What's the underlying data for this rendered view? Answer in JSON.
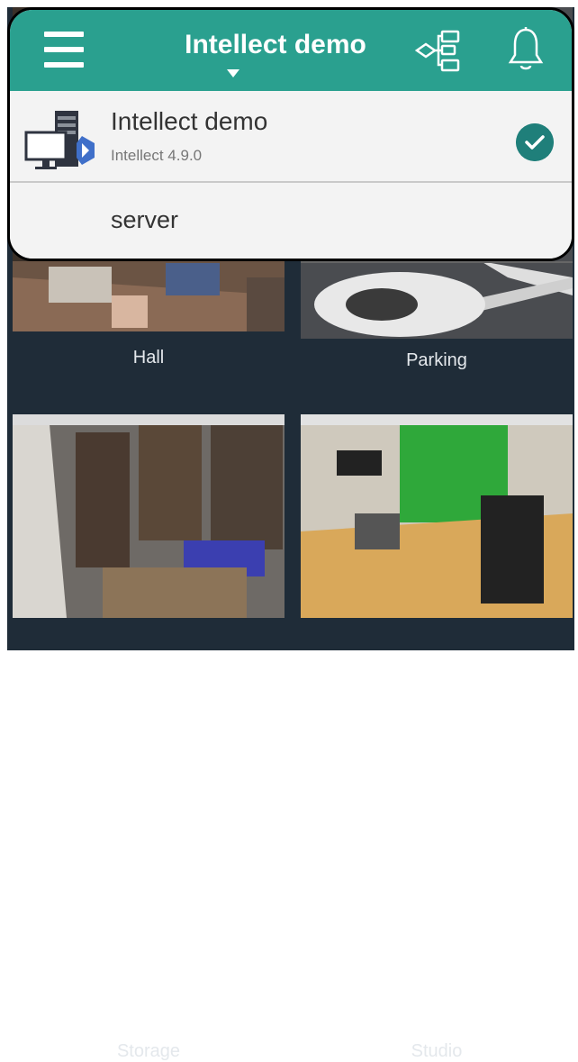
{
  "header": {
    "title": "Intellect demo",
    "menu_icon": "hamburger-menu-icon",
    "tree_icon": "hierarchy-tree-icon",
    "bell_icon": "notification-bell-icon"
  },
  "dropdown": {
    "items": [
      {
        "name": "Intellect demo",
        "version": "Intellect 4.9.0",
        "selected": true,
        "icon": "server-computer-icon"
      },
      {
        "name": "server"
      }
    ]
  },
  "cameras": [
    {
      "name": "Hall"
    },
    {
      "name": "Parking"
    },
    {
      "name": "Storage"
    },
    {
      "name": "Studio"
    }
  ],
  "colors": {
    "accent": "#2aa08f",
    "background": "#1f2c38",
    "check": "#1f7f7a"
  }
}
